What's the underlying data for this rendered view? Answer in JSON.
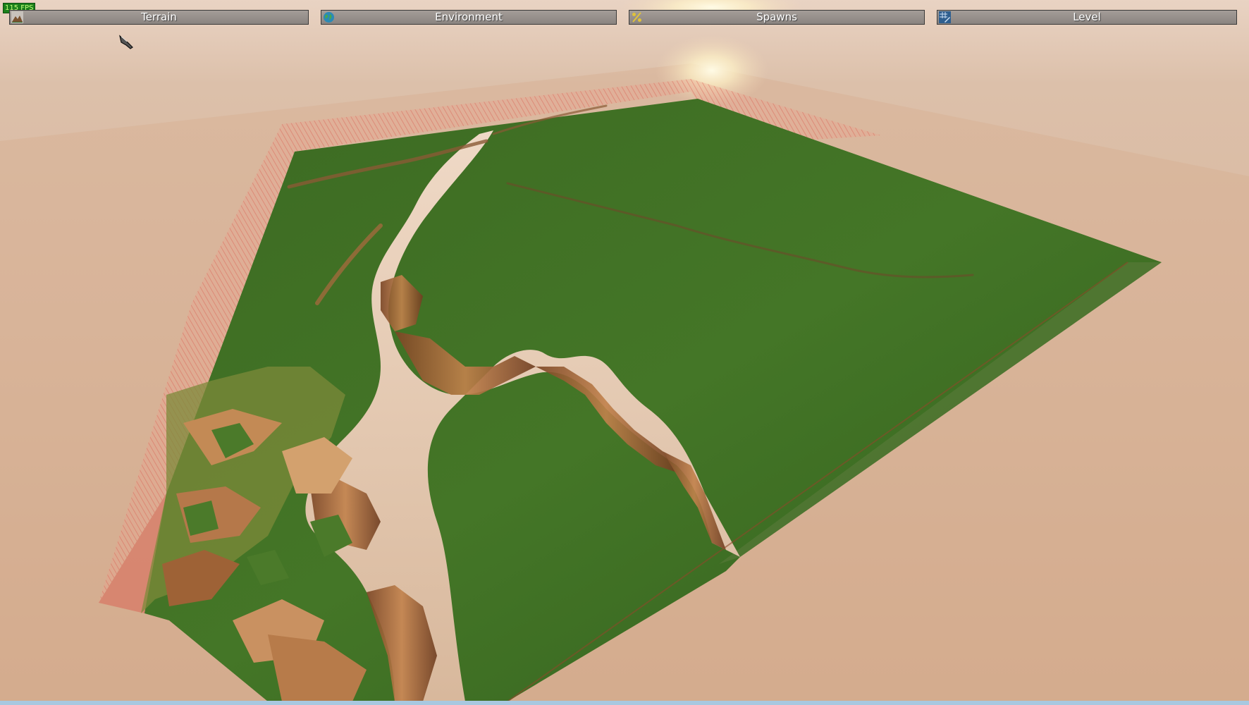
{
  "hud": {
    "fps_label": "115 FPS"
  },
  "toolbar": {
    "tabs": [
      {
        "label": "Terrain",
        "icon": "terrain-icon"
      },
      {
        "label": "Environment",
        "icon": "globe-icon"
      },
      {
        "label": "Spawns",
        "icon": "percent-icon"
      },
      {
        "label": "Level",
        "icon": "level-grid-icon"
      }
    ]
  },
  "colors": {
    "sky_haze": "#d6b49b",
    "grass": "#3f6e22",
    "canyon_rock": "#a0683a",
    "canyon_floor": "#e6d2c2",
    "boundary": "#e06a5e",
    "toolbar_bg": "#98928d"
  }
}
